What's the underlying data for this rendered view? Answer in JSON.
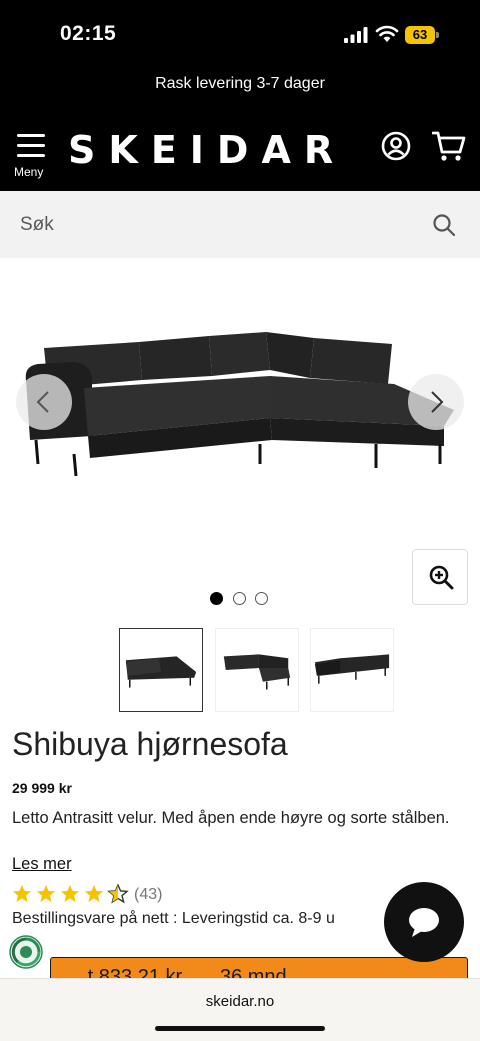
{
  "status": {
    "time": "02:15",
    "battery": "63",
    "icons": [
      "signal-icon",
      "wifi-icon",
      "battery-icon"
    ]
  },
  "promo": {
    "text": "Rask levering 3-7 dager"
  },
  "header": {
    "menu_label": "Meny",
    "logo": "SKEIDAR",
    "icons": [
      "hamburger-icon",
      "account-icon",
      "cart-icon"
    ]
  },
  "search": {
    "placeholder": "Søk",
    "icon": "search-icon"
  },
  "gallery": {
    "slide_count": 3,
    "active_slide": 1,
    "thumbnails": 3,
    "icons": [
      "chevron-left-icon",
      "chevron-right-icon",
      "zoom-in-icon"
    ]
  },
  "product": {
    "title": "Shibuya hjørnesofa",
    "price": "29 999 kr",
    "description": "Letto Antrasitt velur. Med åpen ende høyre og sorte stålben.",
    "read_more": "Les mer",
    "rating": 4.5,
    "rating_max": 5,
    "review_count": "(43)",
    "delivery": "Bestillingsvare på nett : Leveringstid ca. 8-9 u"
  },
  "cta": {
    "label": "...t 833,21 kr... ...36 mnd..."
  },
  "browser": {
    "url": "skeidar.no"
  },
  "colors": {
    "header_bg": "#000000",
    "search_bg": "#f2f2f2",
    "cta": "#f28a1a",
    "star": "#f5c400",
    "eco_badge": "#2e8b57"
  }
}
